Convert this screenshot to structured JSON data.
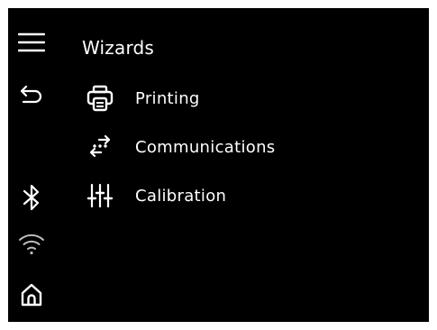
{
  "header": {
    "title": "Wizards"
  },
  "menu": {
    "items": [
      {
        "label": "Printing",
        "icon": "printer-icon"
      },
      {
        "label": "Communications",
        "icon": "communications-icon"
      },
      {
        "label": "Calibration",
        "icon": "sliders-icon"
      }
    ]
  },
  "sidebar": {
    "buttons": [
      {
        "icon": "hamburger-menu-icon"
      },
      {
        "icon": "back-arrow-icon"
      },
      {
        "icon": "bluetooth-icon"
      },
      {
        "icon": "wifi-icon"
      },
      {
        "icon": "home-icon"
      }
    ]
  },
  "colors": {
    "background": "#000000",
    "foreground": "#ffffff",
    "wifi_muted": "#bdbdbd"
  }
}
